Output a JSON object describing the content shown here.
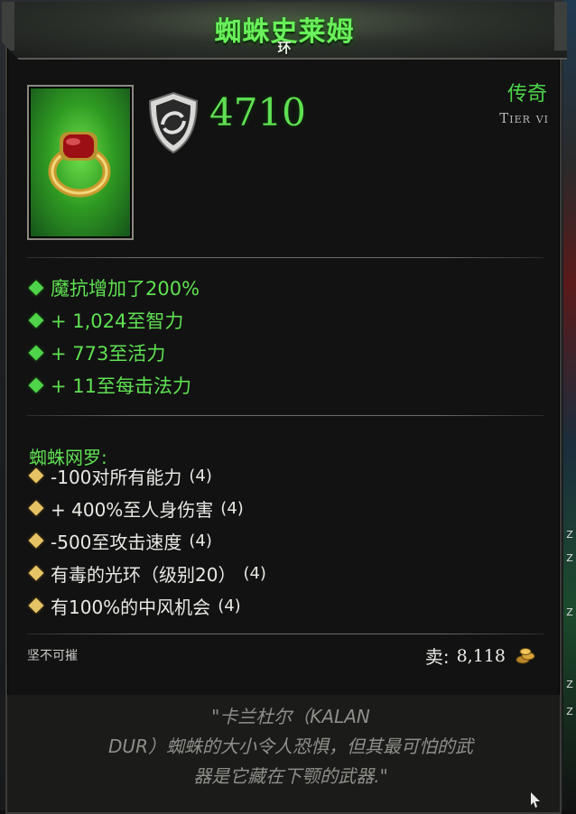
{
  "item": {
    "name": "蜘蛛史莱姆",
    "type": "环",
    "power": "4710",
    "rarity": "传奇",
    "tier": "Tier vi"
  },
  "stats": [
    "魔抗增加了200%",
    "+ 1,024至智力",
    "+ 773至活力",
    "+ 11至每击法力"
  ],
  "set": {
    "title": "蜘蛛网罗:",
    "bonuses": [
      {
        "text": "-100对所有能力",
        "count": "(4)"
      },
      {
        "text": "+ 400%至人身伤害",
        "count": "(4)"
      },
      {
        "text": "-500至攻击速度",
        "count": "(4)"
      },
      {
        "text": "有毒的光环（级别20）",
        "count": "(4)"
      },
      {
        "text": "有100%的中风机会",
        "count": "(4)"
      }
    ]
  },
  "footer": {
    "durability": "坚不可摧",
    "sell_label": "卖:",
    "sell_value": "8,118"
  },
  "flavor": {
    "lines": [
      "\"卡兰杜尔（KALAN",
      "DUR）蜘蛛的大小令人恐惧，但其最可怕的武",
      "器是它藏在下颚的武器.\""
    ]
  },
  "strip": {
    "marks": [
      "Z",
      "Z",
      "Z",
      "Z",
      "Z"
    ]
  },
  "colors": {
    "legendary_green": "#5fe052",
    "set_text": "#e8e8e4",
    "gold_diamond": "#e6c466"
  },
  "icons": [
    "ring-icon",
    "shield-icon",
    "coins-icon",
    "diamond-bullet-icon",
    "cursor-icon"
  ]
}
